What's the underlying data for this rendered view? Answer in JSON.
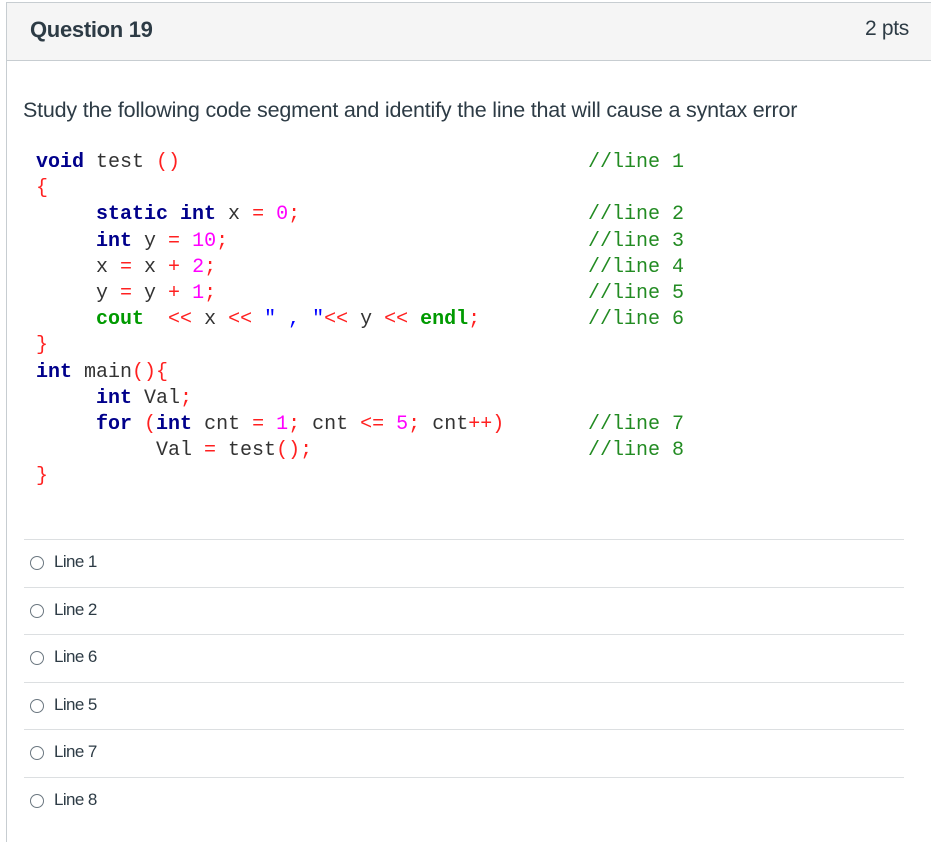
{
  "question": {
    "title": "Question 19",
    "points": "2 pts",
    "prompt": "Study the following code segment and identify the line that will cause a syntax error"
  },
  "code": {
    "lines": [
      {
        "tokens": [
          [
            "kw",
            "void"
          ],
          [
            "id",
            " test"
          ],
          [
            "op",
            " ()"
          ]
        ],
        "comment": "//line 1"
      },
      {
        "tokens": [
          [
            "op",
            "{"
          ]
        ],
        "comment": ""
      },
      {
        "tokens": [
          [
            "id",
            "     "
          ],
          [
            "kw",
            "static int"
          ],
          [
            "id",
            " x "
          ],
          [
            "op",
            "="
          ],
          [
            "num",
            " 0"
          ],
          [
            "op",
            ";"
          ]
        ],
        "comment": "//line 2"
      },
      {
        "tokens": [
          [
            "id",
            "     "
          ],
          [
            "kw",
            "int"
          ],
          [
            "id",
            " y "
          ],
          [
            "op",
            "="
          ],
          [
            "num",
            " 10"
          ],
          [
            "op",
            ";"
          ]
        ],
        "comment": "//line 3"
      },
      {
        "tokens": [
          [
            "id",
            "     x "
          ],
          [
            "op",
            "="
          ],
          [
            "id",
            " x "
          ],
          [
            "op",
            "+"
          ],
          [
            "num",
            " 2"
          ],
          [
            "op",
            ";"
          ]
        ],
        "comment": "//line 4"
      },
      {
        "tokens": [
          [
            "id",
            "     y "
          ],
          [
            "op",
            "="
          ],
          [
            "id",
            " y "
          ],
          [
            "op",
            "+"
          ],
          [
            "num",
            " 1"
          ],
          [
            "op",
            ";"
          ]
        ],
        "comment": "//line 5"
      },
      {
        "tokens": [
          [
            "id",
            "     "
          ],
          [
            "grn",
            "cout"
          ],
          [
            "id",
            "  "
          ],
          [
            "op",
            "<<"
          ],
          [
            "id",
            " x "
          ],
          [
            "op",
            "<<"
          ],
          [
            "str",
            " \" , \""
          ],
          [
            "op",
            "<<"
          ],
          [
            "id",
            " y "
          ],
          [
            "op",
            "<<"
          ],
          [
            "grn",
            " endl"
          ],
          [
            "op",
            ";"
          ]
        ],
        "comment": "//line 6"
      },
      {
        "tokens": [
          [
            "op",
            "}"
          ]
        ],
        "comment": ""
      },
      {
        "tokens": [
          [
            "kw",
            "int"
          ],
          [
            "id",
            " main"
          ],
          [
            "op",
            "(){"
          ]
        ],
        "comment": ""
      },
      {
        "tokens": [
          [
            "id",
            "     "
          ],
          [
            "kw",
            "int"
          ],
          [
            "id",
            " Val"
          ],
          [
            "op",
            ";"
          ]
        ],
        "comment": ""
      },
      {
        "tokens": [
          [
            "id",
            "     "
          ],
          [
            "kw",
            "for"
          ],
          [
            "op",
            " ("
          ],
          [
            "kw",
            "int"
          ],
          [
            "id",
            " cnt "
          ],
          [
            "op",
            "="
          ],
          [
            "num",
            " 1"
          ],
          [
            "op",
            ";"
          ],
          [
            "id",
            " cnt "
          ],
          [
            "op",
            "<="
          ],
          [
            "num",
            " 5"
          ],
          [
            "op",
            ";"
          ],
          [
            "id",
            " cnt"
          ],
          [
            "op",
            "++)"
          ]
        ],
        "comment": "//line 7"
      },
      {
        "tokens": [
          [
            "id",
            "          Val "
          ],
          [
            "op",
            "="
          ],
          [
            "id",
            " test"
          ],
          [
            "op",
            "();"
          ]
        ],
        "comment": "//line 8"
      },
      {
        "tokens": [
          [
            "op",
            "}"
          ]
        ],
        "comment": ""
      }
    ]
  },
  "answers": [
    {
      "label": "Line 1",
      "selected": false
    },
    {
      "label": "Line 2",
      "selected": false
    },
    {
      "label": "Line 6",
      "selected": false
    },
    {
      "label": "Line 5",
      "selected": false
    },
    {
      "label": "Line 7",
      "selected": false
    },
    {
      "label": "Line 8",
      "selected": false
    }
  ]
}
